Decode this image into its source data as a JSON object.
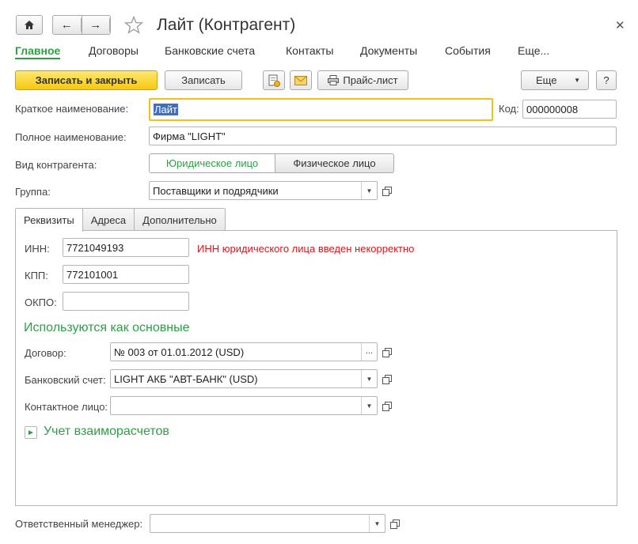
{
  "window": {
    "title": "Лайт (Контрагент)"
  },
  "sections": [
    "Главное",
    "Договоры",
    "Банковские счета",
    "Контакты",
    "Документы",
    "События",
    "Еще..."
  ],
  "toolbar": {
    "save_close": "Записать и закрыть",
    "save": "Записать",
    "price_list": "Прайс-лист",
    "more": "Еще",
    "help": "?"
  },
  "form": {
    "short_name_label": "Краткое наименование:",
    "short_name_value": "Лайт",
    "code_label": "Код:",
    "code_value": "000000008",
    "full_name_label": "Полное наименование:",
    "full_name_value": "Фирма \"LIGHT\"",
    "type_label": "Вид контрагента:",
    "type_legal": "Юридическое лицо",
    "type_individual": "Физическое лицо",
    "group_label": "Группа:",
    "group_value": "Поставщики и подрядчики"
  },
  "tabs": [
    "Реквизиты",
    "Адреса",
    "Дополнительно"
  ],
  "details": {
    "inn_label": "ИНН:",
    "inn_value": "7721049193",
    "inn_error": "ИНН юридического лица введен некорректно",
    "kpp_label": "КПП:",
    "kpp_value": "772101001",
    "okpo_label": "ОКПО:",
    "okpo_value": "",
    "main_header": "Используются как основные",
    "contract_label": "Договор:",
    "contract_value": "№ 003 от 01.01.2012 (USD)",
    "bank_label": "Банковский счет:",
    "bank_value": "LIGHT АКБ \"АВТ-БАНК\" (USD)",
    "contact_label": "Контактное лицо:",
    "contact_value": "",
    "settlements": "Учет взаиморасчетов"
  },
  "footer": {
    "manager_label": "Ответственный менеджер:",
    "manager_value": ""
  },
  "colors": {
    "accent_green": "#2f9e45",
    "primary_yellow": "#f5c810",
    "error_red": "#d8161b",
    "selection_blue": "#3c6fc5"
  }
}
